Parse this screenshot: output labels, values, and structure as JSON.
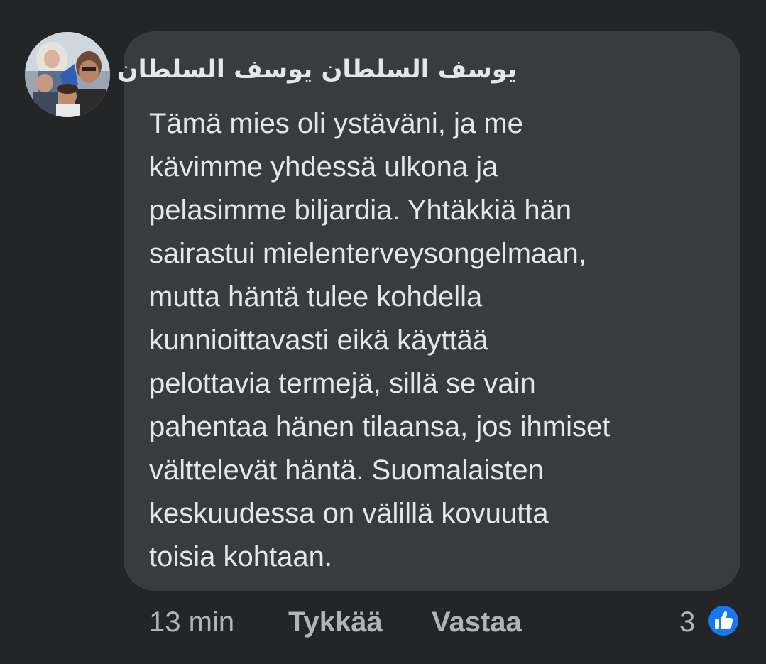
{
  "comment": {
    "author": "يوسف السلطان يوسف السلطان",
    "text_lines": [
      "Tämä mies oli ystäväni, ja me",
      "kävimme yhdessä ulkona ja",
      "pelasimme biljardia. Yhtäkkiä hän",
      "sairastui mielenterveysongelmaan,",
      "mutta häntä tulee kohdella",
      "kunnioittavasti eikä käyttää",
      "pelottavia termejä, sillä se vain",
      "pahentaa hänen tilaansa, jos ihmiset",
      "välttelevät häntä. Suomalaisten",
      "keskuudessa on välillä kovuutta",
      "toisia kohtaan."
    ]
  },
  "footer": {
    "timestamp": "13 min",
    "like_label": "Tykkää",
    "reply_label": "Vastaa",
    "reaction_count": "3"
  },
  "icons": {
    "reaction": "like-thumbs-up-icon",
    "avatar": "profile-photo"
  },
  "colors": {
    "background": "#242526",
    "bubble": "#3a3b3c",
    "primary_text": "#e4e6eb",
    "secondary_text": "#b0b3b8",
    "like_blue": "#1877f2"
  }
}
